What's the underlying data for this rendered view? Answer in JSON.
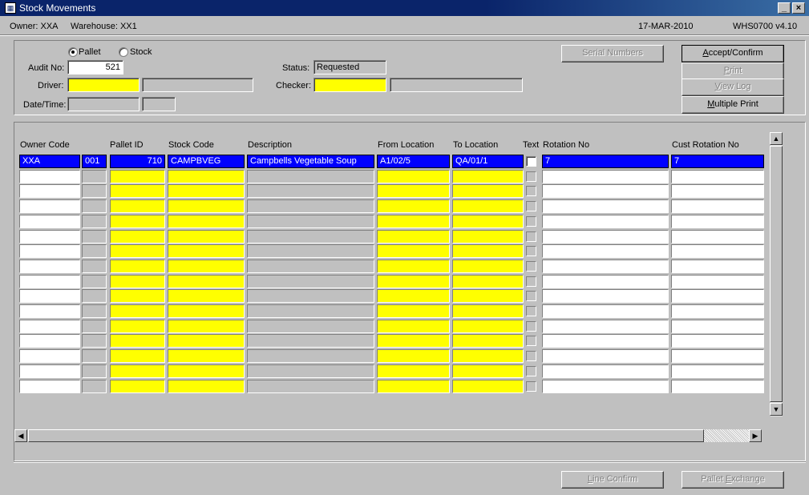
{
  "window": {
    "title": "Stock Movements",
    "minimize": "_",
    "close": "×"
  },
  "info": {
    "owner": "Owner: XXA",
    "warehouse": "Warehouse: XX1",
    "date": "17-MAR-2010",
    "version": "WHS0700  v4.10"
  },
  "header": {
    "radio_pallet": "Pallet",
    "radio_stock": "Stock",
    "selected_radio": "Pallet",
    "audit_label": "Audit No:",
    "audit_value": "521",
    "driver_label": "Driver:",
    "driver_value": "",
    "driver_name": "",
    "datetime_label": "Date/Time:",
    "date_value": "",
    "time_value": "",
    "status_label": "Status:",
    "status_value": "Requested",
    "checker_label": "Checker:",
    "checker_value": "",
    "checker_name": ""
  },
  "buttons": {
    "serial_numbers": "Serial Numbers",
    "accept_confirm": "Accept/Confirm",
    "print": "Print",
    "view_log": "View Log",
    "multiple_print": "Multiple Print",
    "line_confirm": "Line Confirm",
    "pallet_exchange": "Pallet Exchange"
  },
  "table": {
    "columns": [
      "Owner Code",
      "Pallet ID",
      "Stock Code",
      "Description",
      "From Location",
      "To Location",
      "Text",
      "Rotation No",
      "Cust Rotation No"
    ],
    "rows": [
      {
        "owner_code": "XXA",
        "owner_suffix": "001",
        "pallet_id": "710",
        "stock_code": "CAMPBVEG",
        "description": "Campbells Vegetable Soup",
        "from_location": "A1/02/5",
        "to_location": "QA/01/1",
        "text": false,
        "rotation_no": "7",
        "cust_rotation_no": "7"
      }
    ],
    "empty_rows": 15
  },
  "colors": {
    "selected_row": "#0000ff",
    "mandatory_field": "#ffff00",
    "title_bar": "#0a246a"
  }
}
